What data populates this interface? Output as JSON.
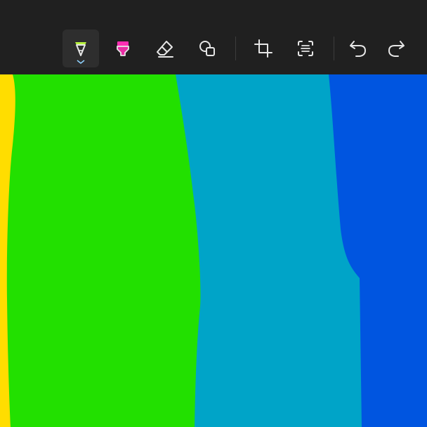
{
  "toolbar": {
    "tools": [
      {
        "id": "ballpoint-pen",
        "icon": "pen-icon",
        "active": true,
        "color": "#b7f23d"
      },
      {
        "id": "highlighter",
        "icon": "highlighter-icon",
        "active": false,
        "color": "#ff2fb3"
      },
      {
        "id": "eraser",
        "icon": "eraser-icon",
        "active": false
      },
      {
        "id": "shapes",
        "icon": "shapes-icon",
        "active": false
      },
      {
        "id": "crop",
        "icon": "crop-icon",
        "active": false
      },
      {
        "id": "text-extract",
        "icon": "text-scan-icon",
        "active": false
      },
      {
        "id": "undo",
        "icon": "undo-icon",
        "active": false
      },
      {
        "id": "redo",
        "icon": "redo-icon",
        "active": false
      }
    ]
  },
  "canvas": {
    "stripes": [
      {
        "name": "yellow",
        "color": "#ffdd00"
      },
      {
        "name": "green",
        "color": "#22e000"
      },
      {
        "name": "teal",
        "color": "#00a4c8"
      },
      {
        "name": "blue",
        "color": "#0055e0"
      }
    ]
  },
  "colors": {
    "toolbar_bg": "#202020",
    "active_tool_bg": "#2e2e2e",
    "icon_stroke": "#e6e6e6"
  }
}
